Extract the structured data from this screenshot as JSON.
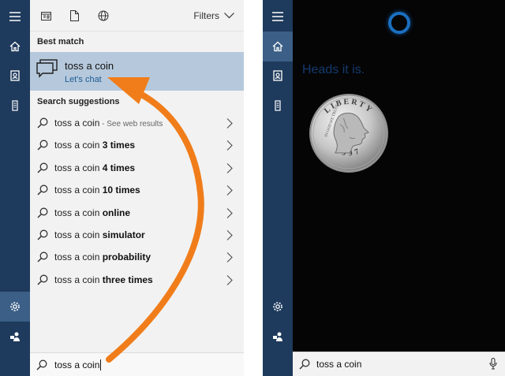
{
  "left_pane": {
    "filters_label": "Filters",
    "best_match_heading": "Best match",
    "best_match": {
      "title": "toss a coin",
      "subtitle": "Let's chat"
    },
    "suggestions_heading": "Search suggestions",
    "suggestions": [
      {
        "prefix": "toss a coin",
        "bold": "",
        "extra": " - See web results"
      },
      {
        "prefix": "toss a coin ",
        "bold": "3 times",
        "extra": ""
      },
      {
        "prefix": "toss a coin ",
        "bold": "4 times",
        "extra": ""
      },
      {
        "prefix": "toss a coin ",
        "bold": "10 times",
        "extra": ""
      },
      {
        "prefix": "toss a coin ",
        "bold": "online",
        "extra": ""
      },
      {
        "prefix": "toss a coin ",
        "bold": "simulator",
        "extra": ""
      },
      {
        "prefix": "toss a coin ",
        "bold": "probability",
        "extra": ""
      },
      {
        "prefix": "toss a coin ",
        "bold": "three times",
        "extra": ""
      }
    ],
    "search_value": "toss a coin"
  },
  "right_pane": {
    "answer_text": "Heads it is.",
    "coin_text": {
      "top": "LIBERTY",
      "date": "1997",
      "motto": "IN GOD WE TRUST"
    },
    "search_value": "toss a coin"
  },
  "icons": {
    "rail": [
      "hamburger-icon",
      "home-icon",
      "notebook-icon",
      "device-icon",
      "settings-icon",
      "feedback-icon"
    ],
    "top": [
      "apps-icon",
      "document-icon",
      "globe-icon"
    ],
    "accent": "#1a6fc0",
    "arrow_color": "#f07d1a"
  }
}
